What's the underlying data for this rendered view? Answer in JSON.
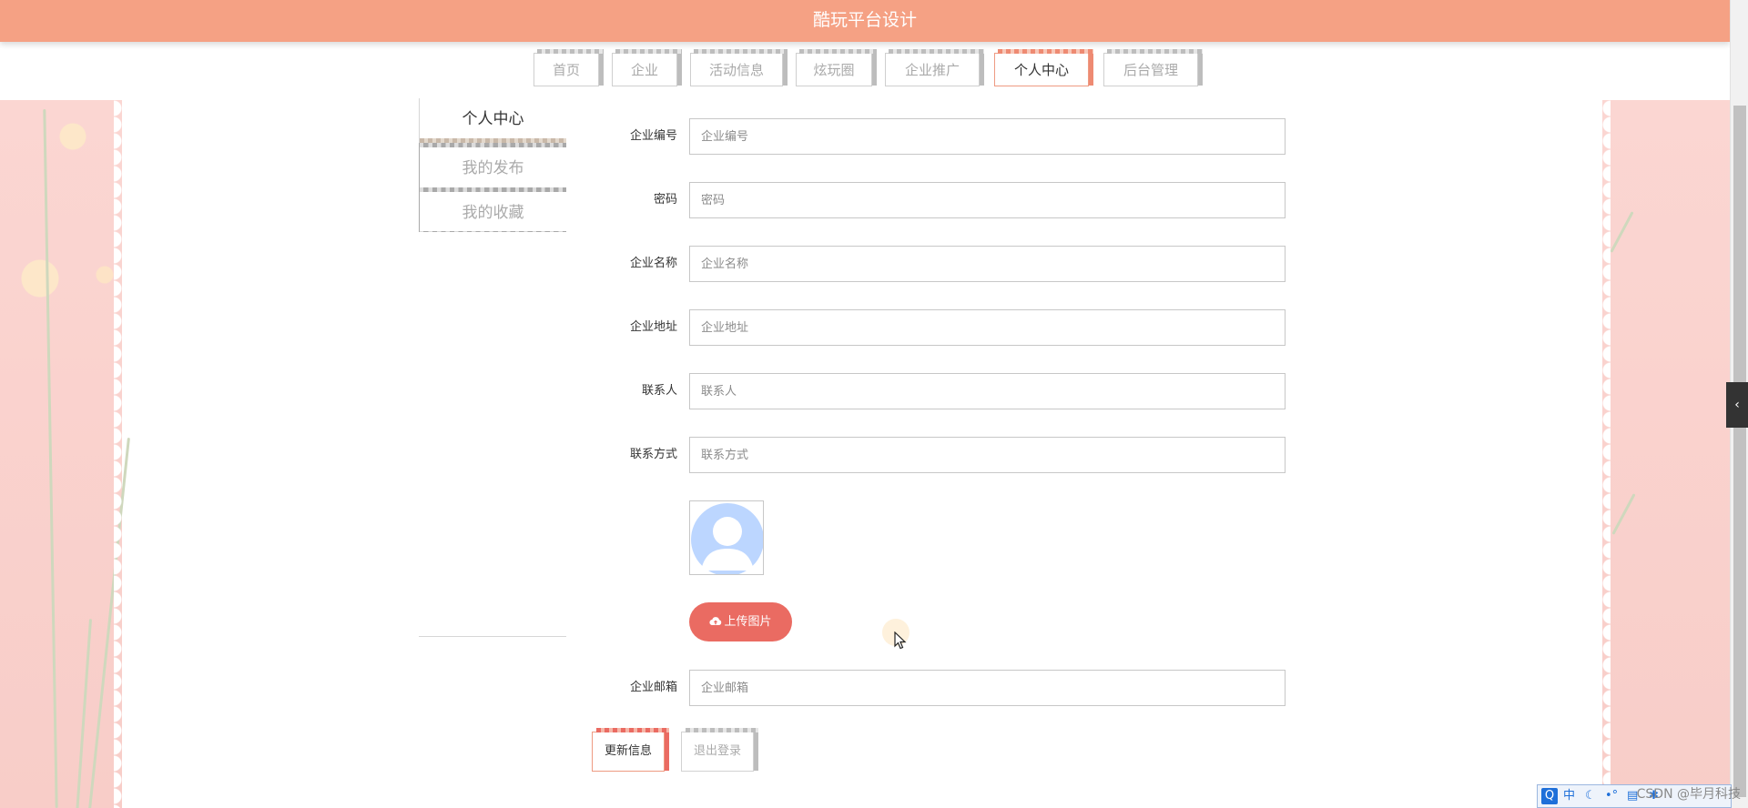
{
  "header": {
    "title": "酷玩平台设计"
  },
  "nav": {
    "tabs": [
      {
        "label": "首页"
      },
      {
        "label": "企业"
      },
      {
        "label": "活动信息"
      },
      {
        "label": "炫玩圈"
      },
      {
        "label": "企业推广"
      },
      {
        "label": "个人中心"
      },
      {
        "label": "后台管理"
      }
    ],
    "active_tab": "个人中心"
  },
  "sidebar": {
    "items": [
      {
        "label": "个人中心"
      },
      {
        "label": "我的发布"
      },
      {
        "label": "我的收藏"
      }
    ]
  },
  "form": {
    "fields": [
      {
        "label": "企业编号",
        "placeholder": "企业编号",
        "value": ""
      },
      {
        "label": "密码",
        "placeholder": "密码",
        "value": ""
      },
      {
        "label": "企业名称",
        "placeholder": "企业名称",
        "value": ""
      },
      {
        "label": "企业地址",
        "placeholder": "企业地址",
        "value": ""
      },
      {
        "label": "联系人",
        "placeholder": "联系人",
        "value": ""
      },
      {
        "label": "联系方式",
        "placeholder": "联系方式",
        "value": ""
      },
      {
        "label": "企业邮箱",
        "placeholder": "企业邮箱",
        "value": ""
      }
    ],
    "upload_button": "上传图片",
    "submit_button": "更新信息",
    "logout_button": "退出登录"
  },
  "taskbar": {
    "ime_label": "中",
    "watermark": "CSDN @毕月科技"
  },
  "colors": {
    "header_bg": "#f5a184",
    "accent": "#ea6b62",
    "side_panel": "#fbd6d2"
  }
}
